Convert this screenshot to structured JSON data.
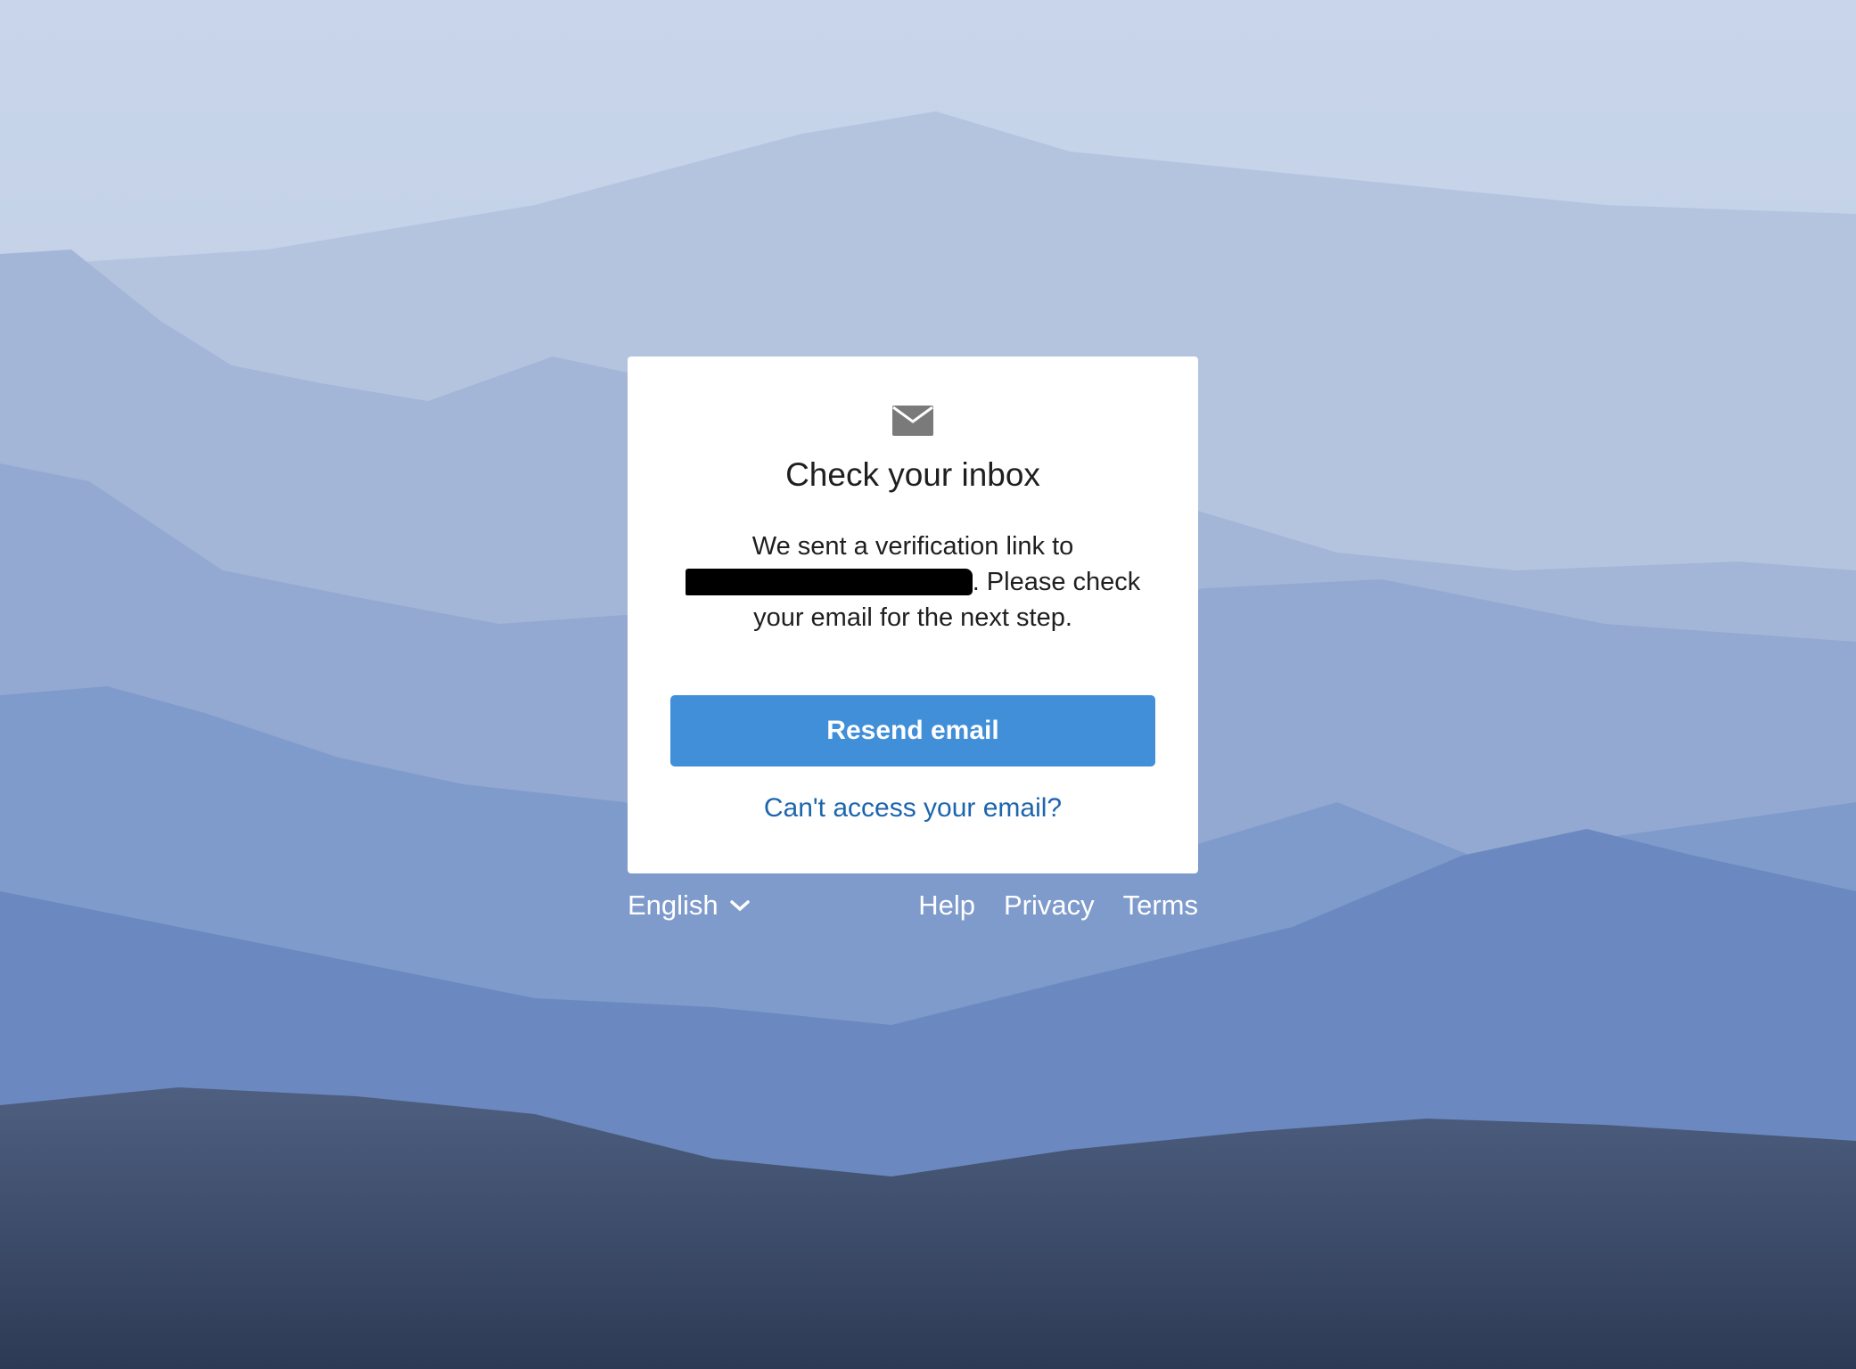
{
  "card": {
    "icon": "envelope-icon",
    "title": "Check your inbox",
    "message_prefix": "We sent a verification link to",
    "message_suffix": ". Please check your email for the next step.",
    "resend_label": "Resend email",
    "cant_access_label": "Can't access your email?"
  },
  "footer": {
    "language": "English",
    "language_icon": "chevron-down-icon",
    "links": [
      "Help",
      "Privacy",
      "Terms"
    ]
  },
  "colors": {
    "button": "#418ed9",
    "link": "#1d65ad",
    "card": "#ffffff"
  }
}
